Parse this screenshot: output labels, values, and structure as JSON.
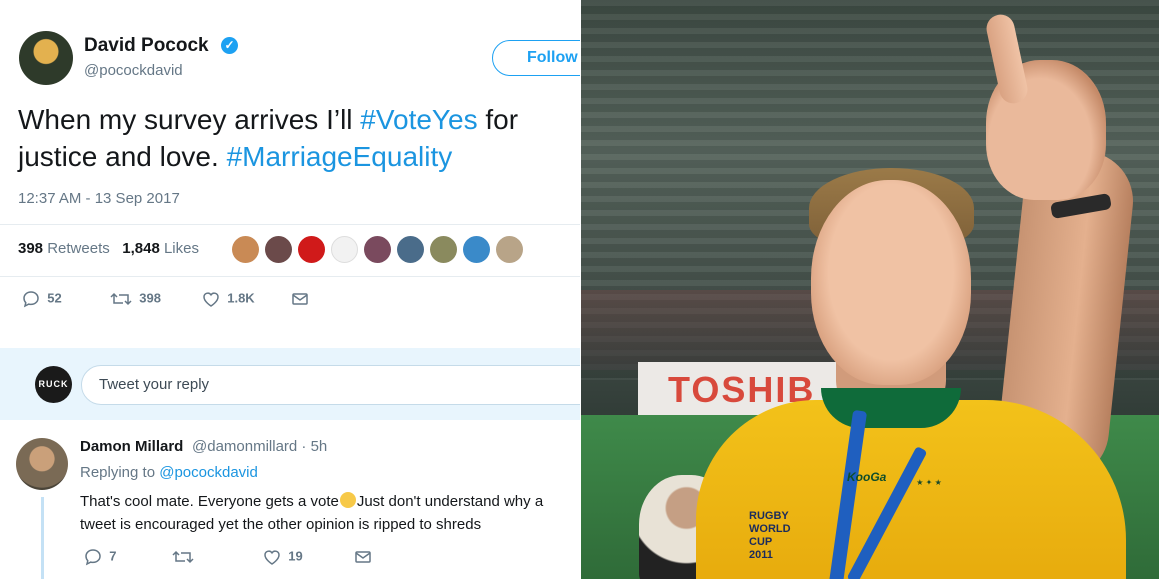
{
  "tweet": {
    "author_name": "David Pocock",
    "author_handle": "@pocockdavid",
    "follow_label": "Follow",
    "text_segments": [
      "When my survey arrives I’ll ",
      "#VoteYes",
      " for",
      "justice and love. ",
      "#MarriageEquality"
    ],
    "timestamp": "12:37 AM - 13 Sep 2017",
    "retweets_count": "398",
    "retweets_label": "Retweets",
    "likes_count": "1,848",
    "likes_label": "Likes",
    "actions": {
      "replies": "52",
      "retweets": "398",
      "likes": "1.8K"
    }
  },
  "reply_box": {
    "avatar_text": "RUCK",
    "placeholder": "Tweet your reply"
  },
  "reply": {
    "name": "Damon Millard",
    "handle": "@damonmillard · 5h",
    "replying_prefix": "Replying to",
    "replying_to": "@pocockdavid",
    "text_line1a": "That's cool mate. Everyone gets a vote",
    "text_line1b": "Just don't understand why a",
    "text_line2": "tweet is encouraged yet the other opinion is ripped to shreds",
    "actions": {
      "replies": "7",
      "likes": "19"
    }
  },
  "photo": {
    "banner_text": "TOSHIB",
    "jersey_brand": "KooGa",
    "rwc_badge_line1": "RUGBY",
    "rwc_badge_line2": "WORLD CUP",
    "rwc_badge_line3": "2011"
  },
  "colors": {
    "accent": "#1da1f2",
    "hashtag": "#1b95e0",
    "muted": "#657786",
    "jersey": "#f3c21a"
  },
  "icons": [
    "verified-badge-icon",
    "reply-icon",
    "retweet-icon",
    "heart-icon",
    "message-icon"
  ]
}
